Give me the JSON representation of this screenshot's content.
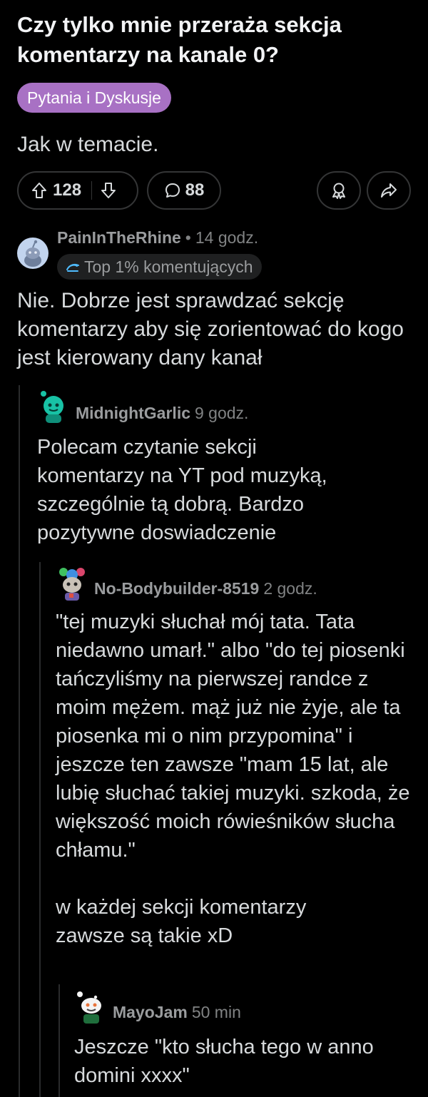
{
  "post": {
    "title": "Czy tylko mnie przeraża sekcja komentarzy na kanale 0?",
    "flair": "Pytania i Dyskusje",
    "flair_color": "#a871c4",
    "body": "Jak w temacie.",
    "upvote_icon": "arrow-up-icon",
    "votes": "128",
    "downvote_icon": "arrow-down-icon",
    "comment_icon": "speech-bubble-icon",
    "comments": "88",
    "award_icon": "award-ribbon-icon",
    "share_icon": "share-arrow-icon"
  },
  "comments": [
    {
      "username": "PainInTheRhine",
      "separator": "•",
      "time": "14 godz.",
      "badge": "Top 1% komentujących",
      "badge_icon": "top-commenter-icon",
      "text": "Nie. Dobrze jest sprawdzać sekcję komentarzy aby się zorientować do kogo jest kierowany dany kanał"
    },
    {
      "username": "MidnightGarlic",
      "time": "9 godz.",
      "text": "Polecam czytanie sekcji komentarzy na YT pod muzyką, szczególnie tą dobrą. Bardzo pozytywne doswiadczenie"
    },
    {
      "username": "No-Bodybuilder-8519",
      "time": "2 godz.",
      "text_p1": "\"tej muzyki słuchał mój tata. Tata niedawno umarł.\" albo \"do tej piosenki tańczyliśmy na pierwszej randce z moim mężem. mąż już nie żyje, ale ta piosenka mi o nim przypomina\" i jeszcze ten zawsze \"mam 15 lat, ale lubię słuchać takiej muzyki. szkoda, że większość moich rówieśników słucha chłamu.\"",
      "text_p2": "w każdej sekcji komentarzy zawsze są takie xD"
    },
    {
      "username": "MayoJam",
      "time": "50 min",
      "text": "Jeszcze \"kto słucha tego w anno domini xxxx\""
    }
  ]
}
